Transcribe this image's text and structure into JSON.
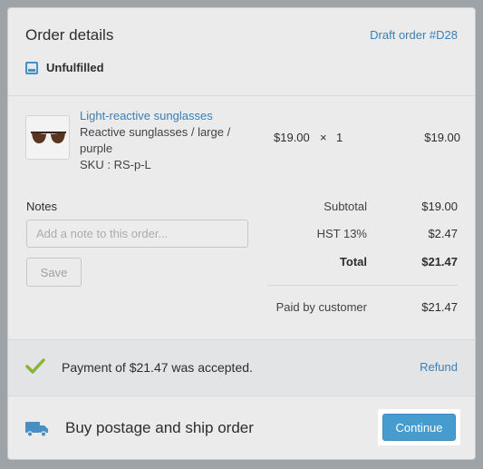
{
  "header": {
    "title": "Order details",
    "draft_link": "Draft order #D28",
    "status": "Unfulfilled"
  },
  "line_item": {
    "name": "Light-reactive sunglasses",
    "variant": "Reactive sunglasses / large / purple",
    "sku": "SKU : RS-p-L",
    "price": "$19.00",
    "times": "×",
    "quantity": "1",
    "total": "$19.00"
  },
  "notes": {
    "label": "Notes",
    "placeholder": "Add a note to this order...",
    "save_label": "Save"
  },
  "totals": {
    "subtotal_label": "Subtotal",
    "subtotal_value": "$19.00",
    "tax_label": "HST 13%",
    "tax_value": "$2.47",
    "total_label": "Total",
    "total_value": "$21.47",
    "paid_label": "Paid by customer",
    "paid_value": "$21.47"
  },
  "payment": {
    "message": "Payment of $21.47 was accepted.",
    "refund_label": "Refund"
  },
  "shipping": {
    "message": "Buy postage and ship order",
    "continue_label": "Continue"
  },
  "icons": {
    "status": "unfulfilled-box-icon",
    "product": "sunglasses-thumbnail",
    "payment": "checkmark-icon",
    "shipping": "truck-icon"
  },
  "colors": {
    "link": "#3a7fb5",
    "accent_button": "#479ccf",
    "check": "#8bb437",
    "truck": "#4a8fc4"
  }
}
